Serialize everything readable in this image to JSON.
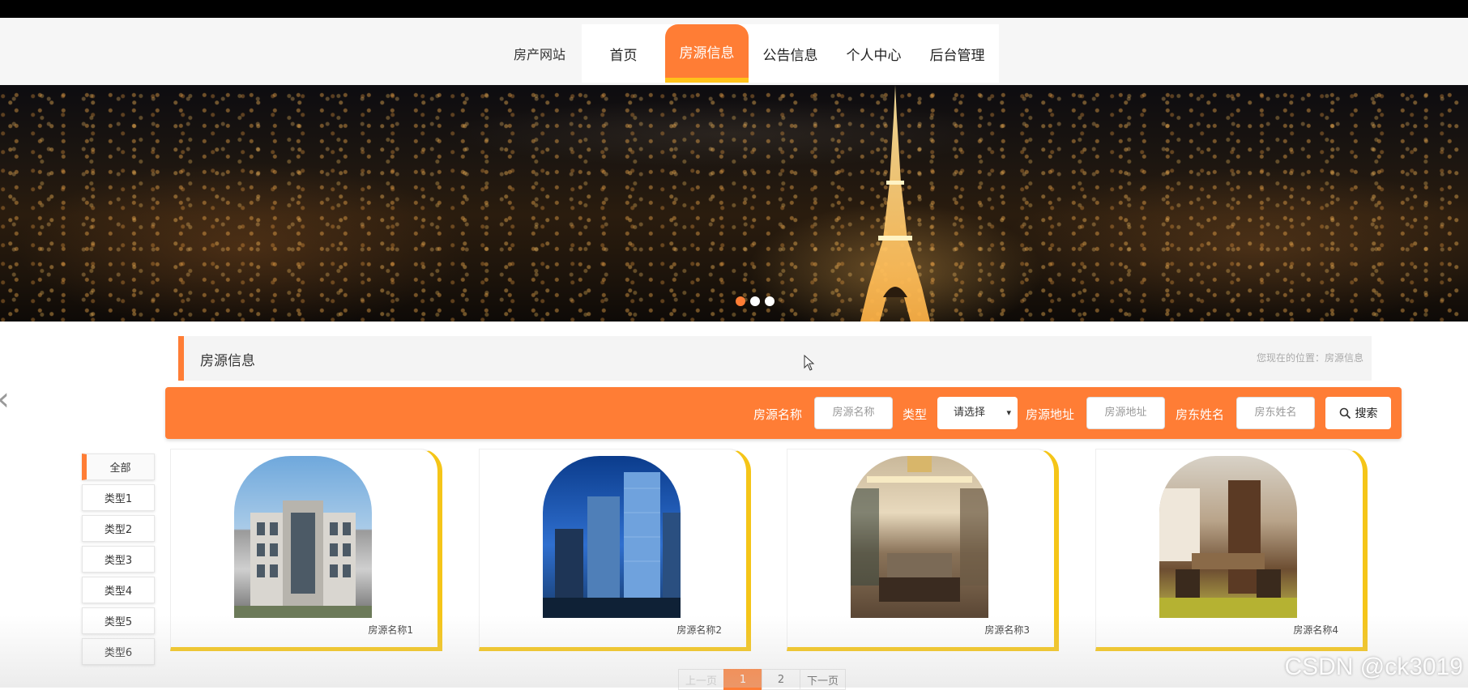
{
  "header": {
    "brand": "房产网站",
    "nav": [
      "首页",
      "房源信息",
      "公告信息",
      "个人中心",
      "后台管理"
    ],
    "active_index": 1
  },
  "banner": {
    "slides": 3,
    "active_slide": 1
  },
  "section": {
    "title": "房源信息",
    "breadcrumb": "您现在的位置：房源信息"
  },
  "search": {
    "name_label": "房源名称",
    "name_placeholder": "房源名称",
    "type_label": "类型",
    "type_selected": "请选择",
    "address_label": "房源地址",
    "address_placeholder": "房源地址",
    "landlord_label": "房东姓名",
    "landlord_placeholder": "房东姓名",
    "button": "搜索"
  },
  "categories": [
    "全部",
    "类型1",
    "类型2",
    "类型3",
    "类型4",
    "类型5",
    "类型6"
  ],
  "listings": [
    {
      "name": "房源名称1",
      "image": "office-building"
    },
    {
      "name": "房源名称2",
      "image": "glass-skyscrapers"
    },
    {
      "name": "房源名称3",
      "image": "living-room"
    },
    {
      "name": "房源名称4",
      "image": "dining-room"
    }
  ],
  "pagination": {
    "prev": "上一页",
    "pages": [
      "1",
      "2"
    ],
    "current": "1",
    "next": "下一页"
  },
  "watermark": "CSDN @ck3019",
  "colors": {
    "accent": "#ff7d35",
    "card_border": "#f5c518"
  }
}
